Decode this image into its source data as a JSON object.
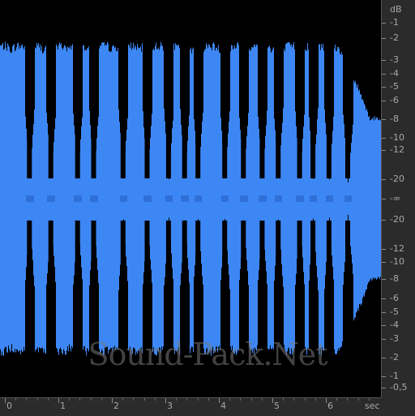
{
  "colors": {
    "waveform": "#3d87f5",
    "waveform_edge": "#2f6fd8",
    "background": "#000000",
    "ruler_bg": "#2b2b2b",
    "ruler_text": "#a8a8a8"
  },
  "db_scale": {
    "unit": "dB",
    "labels": [
      "-1",
      "-2",
      "-3",
      "-4",
      "-5",
      "-6",
      "-8",
      "-10",
      "-12",
      "-20",
      "-∞",
      "-20",
      "-12",
      "-10",
      "-8",
      "-6",
      "-5",
      "-4",
      "-3",
      "-2",
      "-1",
      "-0,5"
    ]
  },
  "time_scale": {
    "unit": "sec",
    "labels": [
      "0",
      "1",
      "2",
      "3",
      "4",
      "5",
      "6"
    ],
    "duration_sec": 6.9
  },
  "watermark": "Sound-Pack.Net",
  "chart_data": {
    "type": "area",
    "title": "",
    "xlabel": "sec",
    "ylabel": "dB",
    "xlim": [
      0,
      6.9
    ],
    "description_series": [
      {
        "name": "",
        "x": [
          0.0,
          0.1,
          0.2,
          0.3,
          0.4,
          0.5,
          0.6,
          0.7,
          0.8,
          0.9,
          1.0,
          1.1,
          1.2,
          1.3,
          1.4,
          1.5,
          1.6,
          1.7,
          1.8,
          1.9,
          2.0,
          2.1,
          2.2,
          2.3,
          2.4,
          2.5,
          2.6,
          2.7,
          2.8,
          2.9,
          3.0,
          3.1,
          3.2,
          3.3,
          3.4,
          3.5,
          3.6,
          3.7,
          3.8,
          3.9,
          4.0,
          4.1,
          4.2,
          4.3,
          4.4,
          4.5,
          4.6,
          4.7,
          4.8,
          4.9,
          5.0,
          5.1,
          5.2,
          5.3,
          5.4,
          5.5,
          5.6,
          5.7,
          5.8,
          5.9,
          6.0,
          6.1,
          6.2,
          6.3,
          6.4,
          6.5,
          6.6,
          6.7,
          6.8,
          6.9
        ],
        "y": [
          0.95,
          0.95,
          0.93,
          0.95,
          0.95,
          0.94,
          0.95,
          0.95,
          0.93,
          0.95,
          0.94,
          0.95,
          0.95,
          0.93,
          0.95,
          0.94,
          0.95,
          0.95,
          0.92,
          0.95,
          0.95,
          0.93,
          0.95,
          0.94,
          0.95,
          0.95,
          0.93,
          0.95,
          0.94,
          0.95,
          0.95,
          0.93,
          0.95,
          0.94,
          0.95,
          0.95,
          0.93,
          0.95,
          0.94,
          0.95,
          0.95,
          0.93,
          0.95,
          0.94,
          0.95,
          0.95,
          0.93,
          0.95,
          0.94,
          0.95,
          0.95,
          0.93,
          0.95,
          0.94,
          0.95,
          0.95,
          0.93,
          0.95,
          0.94,
          0.95,
          0.95,
          0.93,
          0.95,
          0.94,
          0.9,
          0.85,
          0.75,
          0.68,
          0.6,
          0.5
        ]
      }
    ],
    "dip_columns_sec": [
      0.55,
      0.95,
      1.45,
      1.75,
      2.3,
      2.75,
      3.15,
      3.45,
      3.7,
      4.2,
      4.55,
      4.9,
      5.2,
      5.6,
      5.85,
      6.15,
      6.5
    ]
  }
}
